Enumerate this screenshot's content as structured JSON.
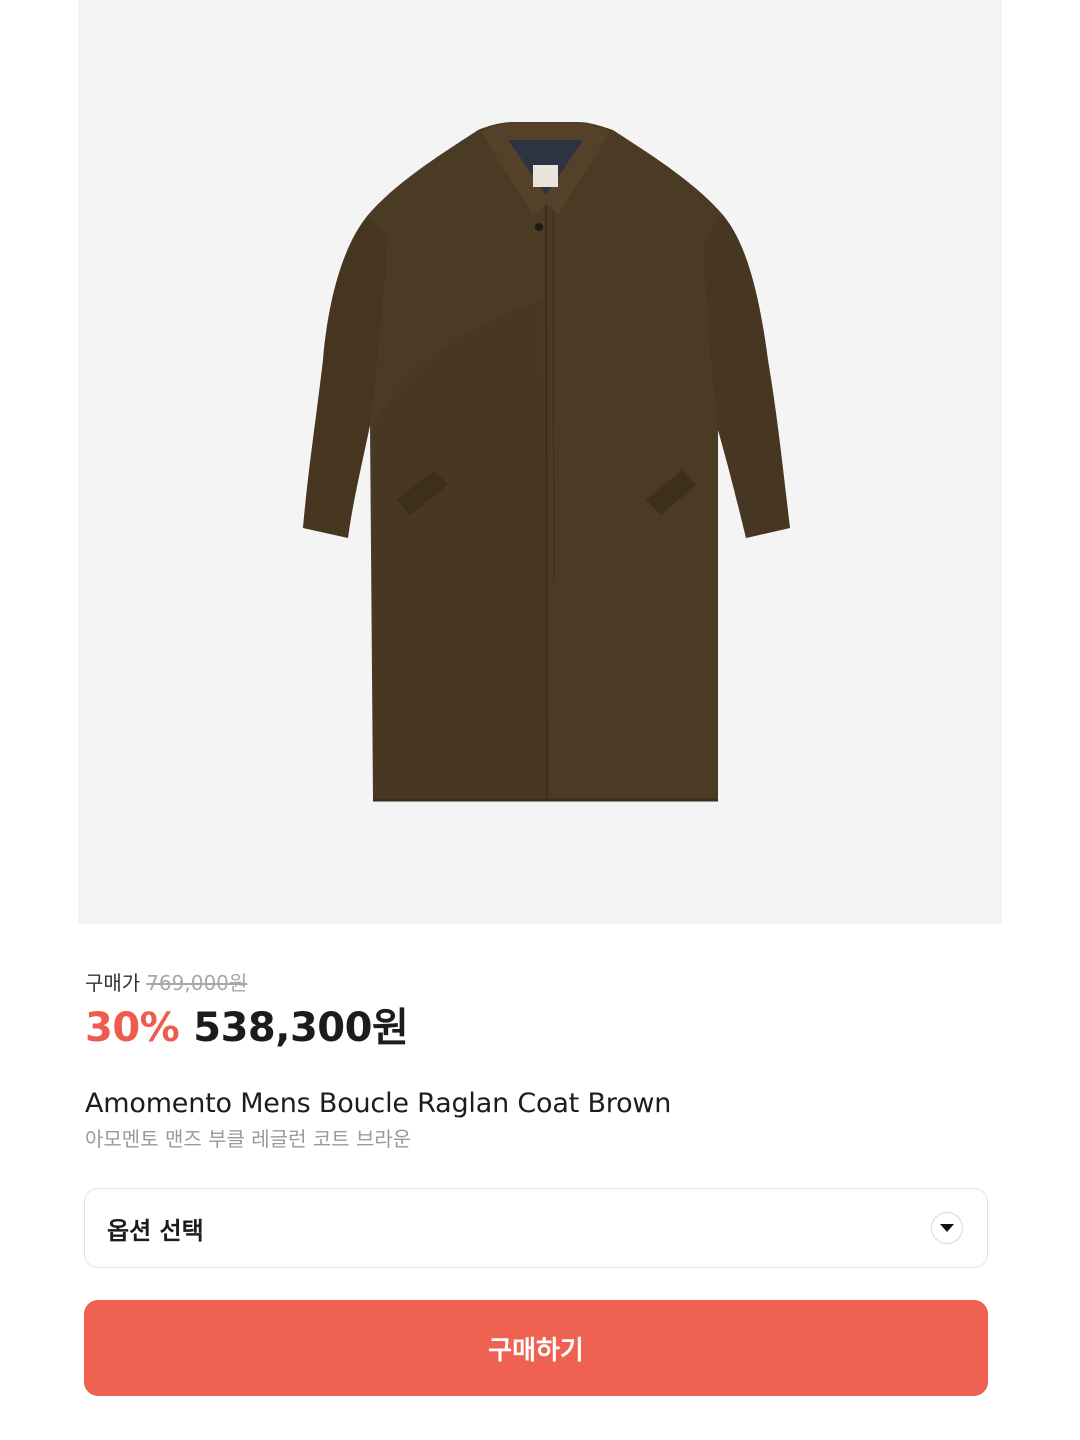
{
  "product": {
    "image_icon": "coat-photo",
    "original_price_label": "구매가",
    "original_price": "769,000원",
    "discount": "30%",
    "sale_price": "538,300원",
    "name_en": "Amomento Mens Boucle Raglan Coat Brown",
    "name_ko": "아모멘토 맨즈 부클 레글런 코트 브라운"
  },
  "option": {
    "label": "옵션 선택",
    "icon": "caret-down-icon"
  },
  "buy_button": {
    "label": "구매하기"
  },
  "colors": {
    "accent": "#ef6151",
    "discount": "#ef5b4c",
    "image_background": "#f4f4f4",
    "coat": "#4b3a24"
  }
}
